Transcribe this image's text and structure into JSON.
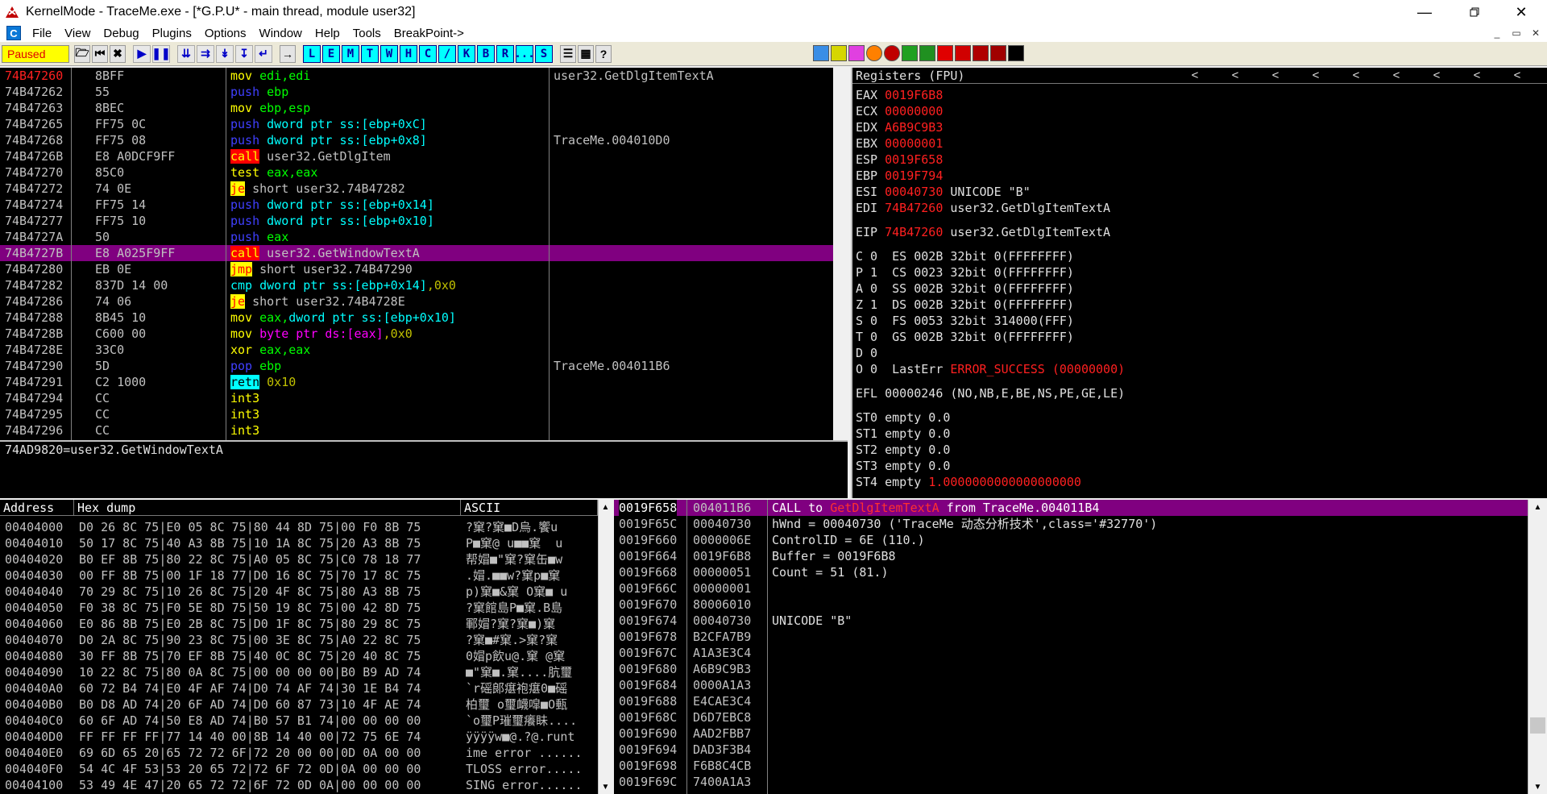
{
  "window": {
    "title": "KernelMode - TraceMe.exe - [*G.P.U* - main thread, module user32]"
  },
  "menu": [
    "File",
    "View",
    "Debug",
    "Plugins",
    "Options",
    "Window",
    "Help",
    "Tools",
    "BreakPoint->"
  ],
  "toolbar": {
    "status": "Paused",
    "letters": [
      "L",
      "E",
      "M",
      "T",
      "W",
      "H",
      "C",
      "/",
      "K",
      "B",
      "R",
      "...",
      "S"
    ]
  },
  "cpu": {
    "rows": [
      {
        "addr": "74B47260",
        "hex": "8BFF",
        "asm": [
          [
            "kw-mov",
            "mov"
          ],
          [
            "op-reg",
            "edi,edi"
          ]
        ],
        "comment": "user32.GetDlgItemTextA"
      },
      {
        "addr": "74B47262",
        "hex": "55",
        "asm": [
          [
            "kw-push",
            "push"
          ],
          [
            "op-reg",
            "ebp"
          ]
        ],
        "comment": ""
      },
      {
        "addr": "74B47263",
        "hex": "8BEC",
        "asm": [
          [
            "kw-mov",
            "mov"
          ],
          [
            "op-reg",
            "ebp,esp"
          ]
        ],
        "comment": ""
      },
      {
        "addr": "74B47265",
        "hex": "FF75 0C",
        "asm": [
          [
            "kw-push",
            "push"
          ],
          [
            "op-mem",
            "dword ptr ss:[ebp+0xC]"
          ]
        ],
        "comment": ""
      },
      {
        "addr": "74B47268",
        "hex": "FF75 08",
        "asm": [
          [
            "kw-push",
            "push"
          ],
          [
            "op-mem",
            "dword ptr ss:[ebp+0x8]"
          ]
        ],
        "comment": "TraceMe.004010D0"
      },
      {
        "addr": "74B4726B",
        "hex": "E8 A0DCF9FF",
        "asm": [
          [
            "kw-call",
            "call"
          ],
          [
            "op-lbl",
            "user32.GetDlgItem"
          ]
        ],
        "comment": ""
      },
      {
        "addr": "74B47270",
        "hex": "85C0",
        "asm": [
          [
            "kw-test",
            "test"
          ],
          [
            "op-reg",
            "eax,eax"
          ]
        ],
        "comment": ""
      },
      {
        "addr": "74B47272",
        "hex": "74 0E",
        "asm": [
          [
            "kw-je",
            "je"
          ],
          [
            "op-lbl",
            "short user32.74B47282"
          ]
        ],
        "comment": ""
      },
      {
        "addr": "74B47274",
        "hex": "FF75 14",
        "asm": [
          [
            "kw-push",
            "push"
          ],
          [
            "op-mem",
            "dword ptr ss:[ebp+0x14]"
          ]
        ],
        "comment": ""
      },
      {
        "addr": "74B47277",
        "hex": "FF75 10",
        "asm": [
          [
            "kw-push",
            "push"
          ],
          [
            "op-mem",
            "dword ptr ss:[ebp+0x10]"
          ]
        ],
        "comment": ""
      },
      {
        "addr": "74B4727A",
        "hex": "50",
        "asm": [
          [
            "kw-push",
            "push"
          ],
          [
            "op-reg",
            "eax"
          ]
        ],
        "comment": ""
      },
      {
        "addr": "74B4727B",
        "hex": "E8 A025F9FF",
        "asm": [
          [
            "kw-call",
            "call"
          ],
          [
            "op-lbl",
            "user32.GetWindowTextA"
          ]
        ],
        "comment": "",
        "selected": true
      },
      {
        "addr": "74B47280",
        "hex": "EB 0E",
        "asm": [
          [
            "kw-jmp",
            "jmp"
          ],
          [
            "op-lbl",
            "short user32.74B47290"
          ]
        ],
        "comment": ""
      },
      {
        "addr": "74B47282",
        "hex": "837D 14 00",
        "asm": [
          [
            "kw-cmp",
            "cmp"
          ],
          [
            "op-mem",
            "dword ptr ss:[ebp+0x14]"
          ],
          [
            "op-imm",
            ",0x0"
          ]
        ],
        "comment": ""
      },
      {
        "addr": "74B47286",
        "hex": "74 06",
        "asm": [
          [
            "kw-je",
            "je"
          ],
          [
            "op-lbl",
            "short user32.74B4728E"
          ]
        ],
        "comment": ""
      },
      {
        "addr": "74B47288",
        "hex": "8B45 10",
        "asm": [
          [
            "kw-mov",
            "mov"
          ],
          [
            "op-reg",
            "eax,"
          ],
          [
            "op-mem",
            "dword ptr ss:[ebp+0x10]"
          ]
        ],
        "comment": ""
      },
      {
        "addr": "74B4728B",
        "hex": "C600 00",
        "asm": [
          [
            "kw-mov",
            "mov"
          ],
          [
            "op-byte",
            "byte ptr ds:[eax]"
          ],
          [
            "op-imm",
            ",0x0"
          ]
        ],
        "comment": ""
      },
      {
        "addr": "74B4728E",
        "hex": "33C0",
        "asm": [
          [
            "kw-xor",
            "xor"
          ],
          [
            "op-reg",
            "eax,eax"
          ]
        ],
        "comment": ""
      },
      {
        "addr": "74B47290",
        "hex": "5D",
        "asm": [
          [
            "kw-pop",
            "pop"
          ],
          [
            "op-reg",
            "ebp"
          ]
        ],
        "comment": "TraceMe.004011B6"
      },
      {
        "addr": "74B47291",
        "hex": "C2 1000",
        "asm": [
          [
            "kw-retn",
            "retn"
          ],
          [
            "op-imm",
            "0x10"
          ]
        ],
        "comment": ""
      },
      {
        "addr": "74B47294",
        "hex": "CC",
        "asm": [
          [
            "kw-int3",
            "int3"
          ]
        ],
        "comment": ""
      },
      {
        "addr": "74B47295",
        "hex": "CC",
        "asm": [
          [
            "kw-int3",
            "int3"
          ]
        ],
        "comment": ""
      },
      {
        "addr": "74B47296",
        "hex": "CC",
        "asm": [
          [
            "kw-int3",
            "int3"
          ]
        ],
        "comment": ""
      }
    ],
    "info": "74AD9820=user32.GetWindowTextA"
  },
  "registers": {
    "title": "Registers (FPU)",
    "gpr": [
      {
        "name": "EAX",
        "val": "0019F6B8",
        "note": ""
      },
      {
        "name": "ECX",
        "val": "00000000",
        "note": ""
      },
      {
        "name": "EDX",
        "val": "A6B9C9B3",
        "note": ""
      },
      {
        "name": "EBX",
        "val": "00000001",
        "note": ""
      },
      {
        "name": "ESP",
        "val": "0019F658",
        "note": ""
      },
      {
        "name": "EBP",
        "val": "0019F794",
        "note": ""
      },
      {
        "name": "ESI",
        "val": "00040730",
        "note": "UNICODE \"B\""
      },
      {
        "name": "EDI",
        "val": "74B47260",
        "note": "user32.GetDlgItemTextA"
      }
    ],
    "eip": {
      "name": "EIP",
      "val": "74B47260",
      "note": "user32.GetDlgItemTextA"
    },
    "flags": [
      "C 0  ES 002B 32bit 0(FFFFFFFF)",
      "P 1  CS 0023 32bit 0(FFFFFFFF)",
      "A 0  SS 002B 32bit 0(FFFFFFFF)",
      "Z 1  DS 002B 32bit 0(FFFFFFFF)",
      "S 0  FS 0053 32bit 314000(FFF)",
      "T 0  GS 002B 32bit 0(FFFFFFFF)",
      "D 0"
    ],
    "lasterr": {
      "prefix": "O 0  LastErr ",
      "val": "ERROR_SUCCESS (00000000)"
    },
    "efl": "EFL 00000246 (NO,NB,E,BE,NS,PE,GE,LE)",
    "fpu": [
      {
        "name": "ST0",
        "text": "empty 0.0",
        "red": false
      },
      {
        "name": "ST1",
        "text": "empty 0.0",
        "red": false
      },
      {
        "name": "ST2",
        "text": "empty 0.0",
        "red": false
      },
      {
        "name": "ST3",
        "text": "empty 0.0",
        "red": false
      },
      {
        "name": "ST4",
        "text": "empty ",
        "redtext": "1.0000000000000000000",
        "red": true
      }
    ]
  },
  "dump": {
    "headers": {
      "address": "Address",
      "hex": "Hex dump",
      "ascii": "ASCII"
    },
    "rows": [
      {
        "a": "00404000",
        "h": "D0 26 8C 75|E0 05 8C 75|80 44 8D 75|00 F0 8B 75",
        "s": "?窠?窠■D烏.饗u"
      },
      {
        "a": "00404010",
        "h": "50 17 8C 75|40 A3 8B 75|10 1A 8C 75|20 A3 8B 75",
        "s": "P■窠@ u■■窠  u"
      },
      {
        "a": "00404020",
        "h": "B0 EF 8B 75|80 22 8C 75|A0 05 8C 75|C0 78 18 77",
        "s": "帮媢■\"窠?窠缶■w"
      },
      {
        "a": "00404030",
        "h": "00 FF 8B 75|00 1F 18 77|D0 16 8C 75|70 17 8C 75",
        "s": ".媢.■■w?窠p■窠"
      },
      {
        "a": "00404040",
        "h": "70 29 8C 75|10 26 8C 75|20 4F 8C 75|80 A3 8B 75",
        "s": "p)窠■&窠 O窠■ u"
      },
      {
        "a": "00404050",
        "h": "F0 38 8C 75|F0 5E 8D 75|50 19 8C 75|00 42 8D 75",
        "s": "?窠館島P■窠.B島"
      },
      {
        "a": "00404060",
        "h": "E0 86 8B 75|E0 2B 8C 75|D0 1F 8C 75|80 29 8C 75",
        "s": "鄆媢?窠?窠■)窠"
      },
      {
        "a": "00404070",
        "h": "D0 2A 8C 75|90 23 8C 75|00 3E 8C 75|A0 22 8C 75",
        "s": "?窠■#窠.>窠?窠"
      },
      {
        "a": "00404080",
        "h": "30 FF 8B 75|70 EF 8B 75|40 0C 8C 75|20 40 8C 75",
        "s": "0媢p飲u@.窠 @窠"
      },
      {
        "a": "00404090",
        "h": "10 22 8C 75|80 0A 8C 75|00 00 00 00|B0 B9 AD 74",
        "s": "■\"窠■.窠....肮璽"
      },
      {
        "a": "004040A0",
        "h": "60 72 B4 74|E0 4F AF 74|D0 74 AF 74|30 1E B4 74",
        "s": "`r磘郞瘎袍瘎0■磘"
      },
      {
        "a": "004040B0",
        "h": "B0 D8 AD 74|20 6F AD 74|D0 60 87 73|10 4F AE 74",
        "s": "柏璽 o璽衊噑■O甀"
      },
      {
        "a": "004040C0",
        "h": "60 6F AD 74|50 E8 AD 74|B0 57 B1 74|00 00 00 00",
        "s": "`o璽P璀璽癢眛...."
      },
      {
        "a": "004040D0",
        "h": "FF FF FF FF|77 14 40 00|8B 14 40 00|72 75 6E 74",
        "s": "ÿÿÿÿw■@.?@.runt"
      },
      {
        "a": "004040E0",
        "h": "69 6D 65 20|65 72 72 6F|72 20 00 00|0D 0A 00 00",
        "s": "ime error ......"
      },
      {
        "a": "004040F0",
        "h": "54 4C 4F 53|53 20 65 72|72 6F 72 0D|0A 00 00 00",
        "s": "TLOSS error....."
      },
      {
        "a": "00404100",
        "h": "53 49 4E 47|20 65 72 72|6F 72 0D 0A|00 00 00 00",
        "s": "SING error......"
      }
    ]
  },
  "stack": {
    "rows": [
      {
        "a": "0019F658",
        "v": "004011B6",
        "c": ""
      },
      {
        "a": "0019F65C",
        "v": "00040730",
        "c": "hWnd = 00040730 ('TraceMe 动态分析技术',class='#32770')"
      },
      {
        "a": "0019F660",
        "v": "0000006E",
        "c": "ControlID = 6E (110.)"
      },
      {
        "a": "0019F664",
        "v": "0019F6B8",
        "c": "Buffer = 0019F6B8"
      },
      {
        "a": "0019F668",
        "v": "00000051",
        "c": "Count = 51 (81.)"
      },
      {
        "a": "0019F66C",
        "v": "00000001",
        "c": ""
      },
      {
        "a": "0019F670",
        "v": "80006010",
        "c": ""
      },
      {
        "a": "0019F674",
        "v": "00040730",
        "c": "UNICODE \"B\""
      },
      {
        "a": "0019F678",
        "v": "B2CFA7B9",
        "c": ""
      },
      {
        "a": "0019F67C",
        "v": "A1A3E3C4",
        "c": ""
      },
      {
        "a": "0019F680",
        "v": "A6B9C9B3",
        "c": ""
      },
      {
        "a": "0019F684",
        "v": "0000A1A3",
        "c": ""
      },
      {
        "a": "0019F688",
        "v": "E4CAE3C4",
        "c": ""
      },
      {
        "a": "0019F68C",
        "v": "D6D7EBC8",
        "c": ""
      },
      {
        "a": "0019F690",
        "v": "AAD2FBB7",
        "c": ""
      },
      {
        "a": "0019F694",
        "v": "DAD3F3B4",
        "c": ""
      },
      {
        "a": "0019F698",
        "v": "F6B8C4CB",
        "c": ""
      },
      {
        "a": "0019F69C",
        "v": "7400A1A3",
        "c": ""
      }
    ],
    "call": {
      "prefix": "CALL to ",
      "fn": "GetDlgItemTextA",
      "suffix": " from TraceMe.004011B4"
    }
  },
  "colors": {
    "selection": "#800080",
    "accent": "#ff2020",
    "background": "#000000"
  }
}
